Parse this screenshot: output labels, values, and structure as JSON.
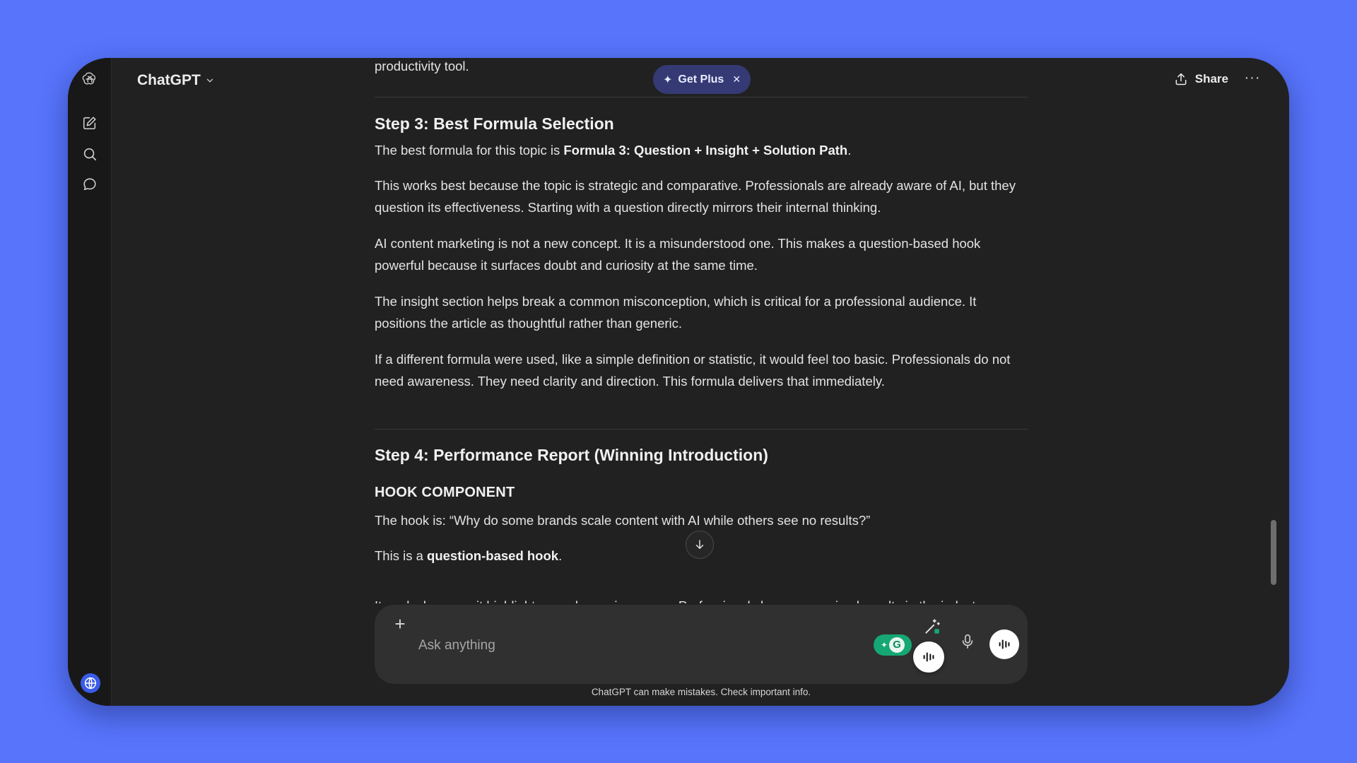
{
  "app": {
    "title": "ChatGPT",
    "get_plus_label": "Get Plus",
    "share_label": "Share",
    "more_label": "···"
  },
  "rail": {
    "icons": [
      "openai-logo-icon",
      "new-chat-icon",
      "search-icon",
      "chats-icon",
      "account-avatar-icon"
    ]
  },
  "conversation": {
    "prev_tail": "productivity tool.",
    "step3": {
      "heading": "Step 3: Best Formula Selection",
      "line1_prefix": "The best formula for this topic is ",
      "line1_bold": "Formula 3: Question + Insight + Solution Path",
      "line1_suffix": ".",
      "p2": "This works best because the topic is strategic and comparative. Professionals are already aware of AI, but they question its effectiveness. Starting with a question directly mirrors their internal thinking.",
      "p3": "AI content marketing is not a new concept. It is a misunderstood one. This makes a question-based hook powerful because it surfaces doubt and curiosity at the same time.",
      "p4": "The insight section helps break a common misconception, which is critical for a professional audience. It positions the article as thoughtful rather than generic.",
      "p5": "If a different formula were used, like a simple definition or statistic, it would feel too basic. Professionals do not need awareness. They need clarity and direction. This formula delivers that immediately."
    },
    "step4": {
      "heading": "Step 4: Performance Report (Winning Introduction)",
      "subheading": "HOOK COMPONENT",
      "hook_line": "The hook is: “Why do some brands scale content with AI while others see no results?”",
      "type_prefix": "This is a ",
      "type_bold": "question-based hook",
      "type_suffix": ".",
      "cut_line": "It works because it highlights a real experience gap. Professionals have seen mixed results in the industry"
    }
  },
  "composer": {
    "placeholder": "Ask anything",
    "grammarly_label": "G"
  },
  "footer": {
    "disclaimer": "ChatGPT can make mistakes. Check important info."
  },
  "colors": {
    "background": "#5774fb",
    "window": "#212121",
    "get_plus_bg": "#353a74",
    "grammarly": "#15a774"
  }
}
